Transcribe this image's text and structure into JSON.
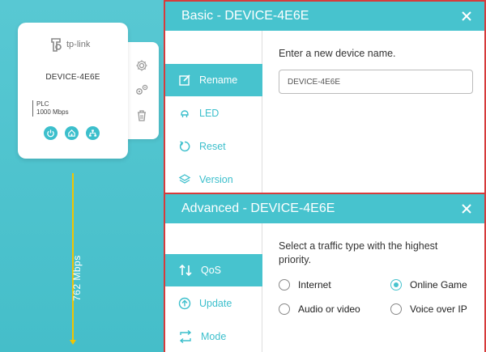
{
  "device": {
    "brand": "tp-link",
    "name": "DEVICE-4E6E",
    "plc_label": "PLC",
    "plc_speed": "1000 Mbps",
    "status_icons": [
      "power-icon",
      "home-icon",
      "network-icon"
    ],
    "actions": [
      "settings-icon",
      "advanced-settings-icon",
      "trash-icon"
    ]
  },
  "link": {
    "rate_label": "762 Mbps"
  },
  "basic": {
    "title": "Basic - DEVICE-4E6E",
    "nav": [
      {
        "label": "Rename",
        "icon": "edit-icon",
        "active": true
      },
      {
        "label": "LED",
        "icon": "bulb-icon",
        "active": false
      },
      {
        "label": "Reset",
        "icon": "reset-icon",
        "active": false
      },
      {
        "label": "Version",
        "icon": "layers-icon",
        "active": false
      }
    ],
    "rename": {
      "prompt": "Enter a new device name.",
      "value": "DEVICE-4E6E"
    }
  },
  "advanced": {
    "title": "Advanced - DEVICE-4E6E",
    "nav": [
      {
        "label": "QoS",
        "icon": "sort-icon",
        "active": true
      },
      {
        "label": "Update",
        "icon": "upload-icon",
        "active": false
      },
      {
        "label": "Mode",
        "icon": "swap-icon",
        "active": false
      }
    ],
    "qos": {
      "prompt": "Select a traffic type with the highest priority.",
      "options": [
        {
          "label": "Internet",
          "checked": false
        },
        {
          "label": "Online Game",
          "checked": true
        },
        {
          "label": "Audio or video",
          "checked": false
        },
        {
          "label": "Voice over IP",
          "checked": false
        }
      ]
    }
  },
  "colors": {
    "accent": "#47c3ce",
    "border_red": "#d63c3c",
    "link_yellow": "#f2c400"
  }
}
